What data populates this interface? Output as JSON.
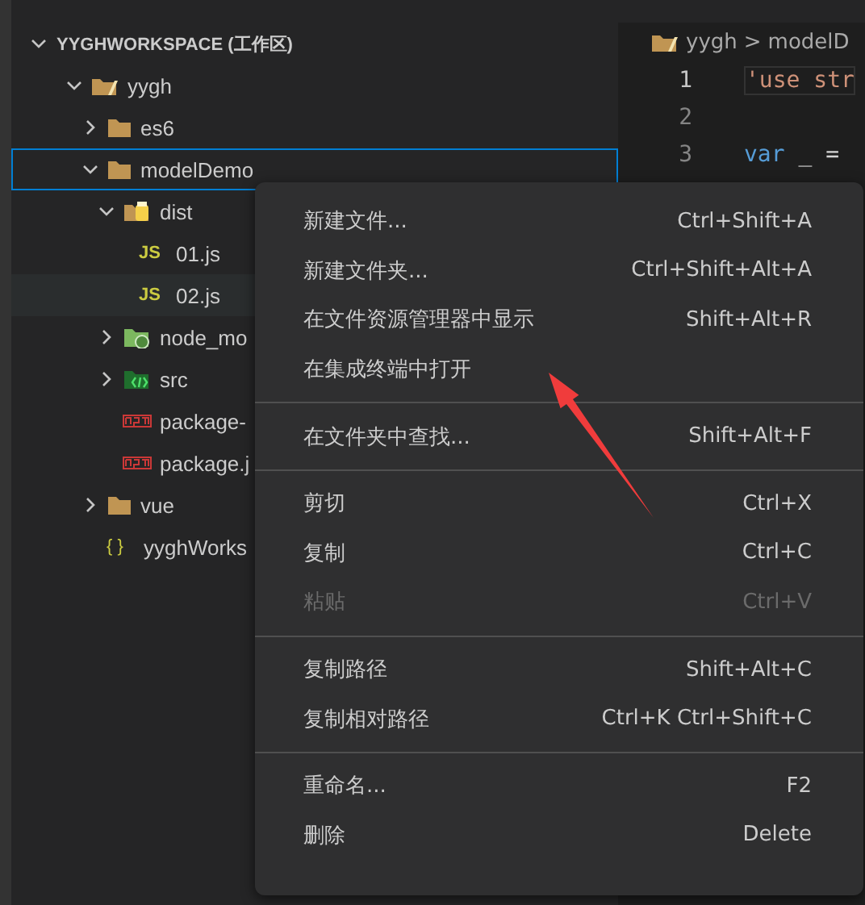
{
  "explorer": {
    "workspace_title": "YYGHWORKSPACE (工作区)",
    "expanded": true,
    "tree": [
      {
        "label": "yygh",
        "kind": "root",
        "expanded": true,
        "children": [
          {
            "label": "es6",
            "kind": "folder",
            "expanded": false
          },
          {
            "label": "modelDemo",
            "kind": "folder",
            "expanded": true,
            "selected": true,
            "children": [
              {
                "label": "dist",
                "kind": "dist",
                "expanded": true,
                "children": [
                  {
                    "label": "01.js",
                    "kind": "js",
                    "icon_text": "JS",
                    "hovered": false
                  },
                  {
                    "label": "02.js",
                    "kind": "js",
                    "icon_text": "JS",
                    "hovered": true
                  }
                ]
              },
              {
                "label": "node_mo",
                "kind": "node",
                "expanded": false
              },
              {
                "label": "src",
                "kind": "src",
                "expanded": false
              },
              {
                "label": "package-",
                "kind": "npm"
              },
              {
                "label": "package.j",
                "kind": "npm"
              }
            ]
          },
          {
            "label": "vue",
            "kind": "folder",
            "expanded": false
          },
          {
            "label": "yyghWorks",
            "kind": "json",
            "icon_text": "{ }"
          }
        ]
      }
    ]
  },
  "editor": {
    "breadcrumb": [
      "yygh",
      "modelD"
    ],
    "breadcrumb_separator": ">",
    "lines": [
      {
        "number": "1",
        "code": "'use str",
        "kind": "string"
      },
      {
        "number": "2"
      },
      {
        "number": "3",
        "code": "var _ =",
        "kind": "keyword"
      }
    ]
  },
  "context_menu": {
    "groups": [
      [
        {
          "label": "新建文件...",
          "shortcut": "Ctrl+Shift+A",
          "disabled": false
        },
        {
          "label": "新建文件夹...",
          "shortcut": "Ctrl+Shift+Alt+A",
          "disabled": false
        },
        {
          "label": "在文件资源管理器中显示",
          "shortcut": "Shift+Alt+R",
          "disabled": false
        },
        {
          "label": "在集成终端中打开",
          "disabled": false
        }
      ],
      [
        {
          "label": "在文件夹中查找...",
          "shortcut": "Shift+Alt+F",
          "disabled": false
        }
      ],
      [
        {
          "label": "剪切",
          "shortcut": "Ctrl+X",
          "disabled": false
        },
        {
          "label": "复制",
          "shortcut": "Ctrl+C",
          "disabled": false
        },
        {
          "label": "粘贴",
          "shortcut": "Ctrl+V",
          "disabled": true
        }
      ],
      [
        {
          "label": "复制路径",
          "shortcut": "Shift+Alt+C",
          "disabled": false
        },
        {
          "label": "复制相对路径",
          "shortcut": "Ctrl+K Ctrl+Shift+C",
          "disabled": false
        }
      ],
      [
        {
          "label": "重命名...",
          "shortcut": "F2",
          "disabled": false
        },
        {
          "label": "删除",
          "shortcut": "Delete",
          "disabled": false
        }
      ]
    ]
  },
  "annotation": {
    "kind": "arrow",
    "color": "#f03c3c"
  }
}
